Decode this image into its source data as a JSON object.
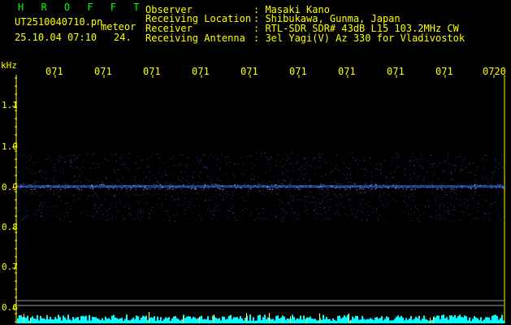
{
  "header": {
    "program": "H R O F F T",
    "filename": "UT2510040710.pn",
    "mode": "meteor",
    "datetime": "25.10.04 07:10",
    "index": "24.",
    "fields": [
      {
        "label": "Observer",
        "value": ": Masaki Kano"
      },
      {
        "label": "Receiving Location",
        "value": ": Shibukawa, Gunma, Japan"
      },
      {
        "label": "Receiver",
        "value": ": RTL-SDR SDR# 43dB L15 103.2MHz CW"
      },
      {
        "label": "Receiving Antenna",
        "value": ": 3el Yagi(V) Az 330 for Vladivostok"
      }
    ]
  },
  "axis": {
    "unit": "kHz",
    "time_ticks": [
      "071",
      "071",
      "071",
      "071",
      "071",
      "071",
      "071",
      "071",
      "071",
      "0720"
    ],
    "freq_ticks": [
      "1.1",
      "1.0",
      "0.9",
      "0.8",
      "0.7",
      "0.6"
    ]
  },
  "colors": {
    "text": "#ffff00",
    "program": "#00ff00",
    "signal": "#3f6fff",
    "baseline": "#00ffff",
    "background": "#000000"
  },
  "signal": {
    "center_khz": 0.9
  }
}
